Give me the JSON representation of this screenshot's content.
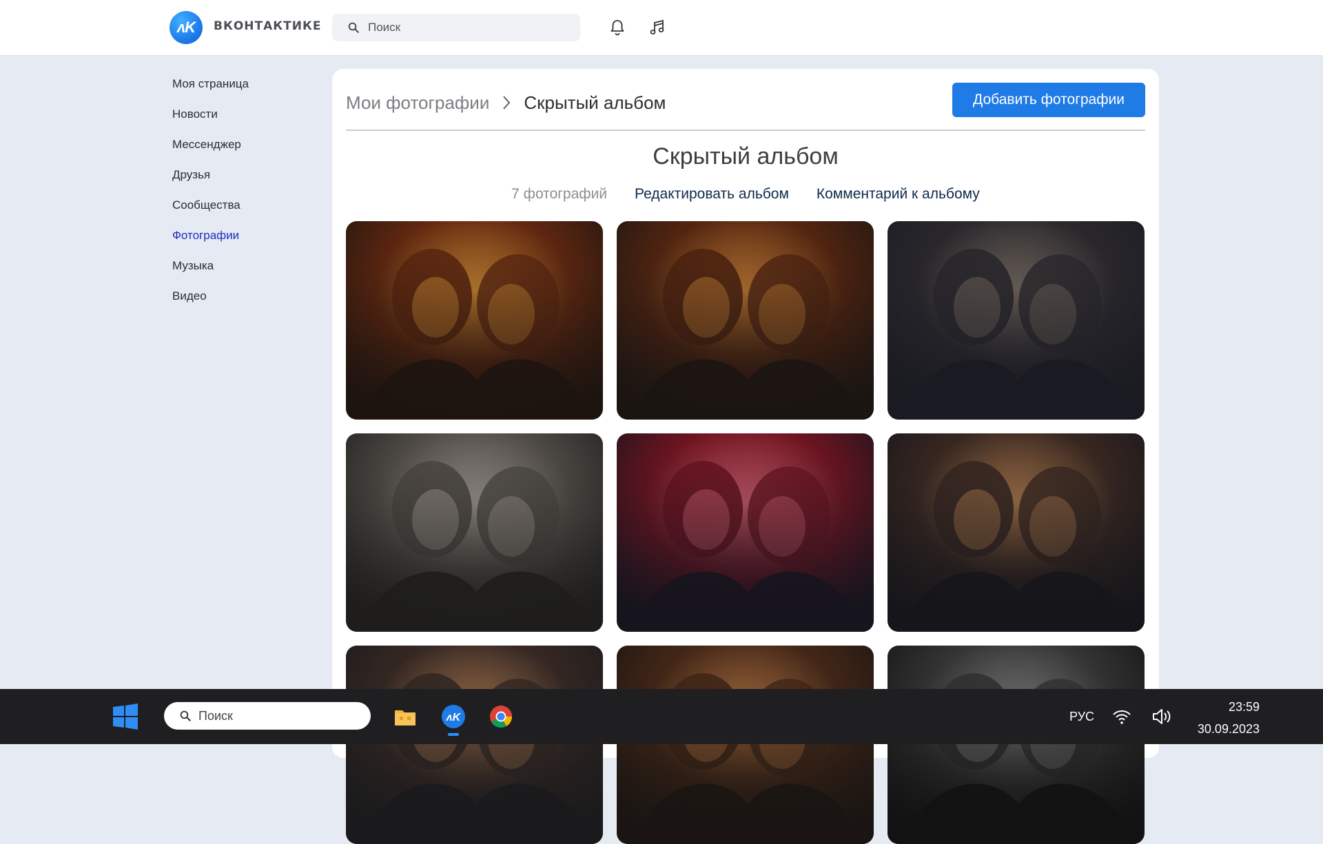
{
  "header": {
    "brand": "ВКОНТАКТИКЕ",
    "logo_letters": "ᴧK",
    "search_placeholder": "Поиск",
    "icons": [
      "bell-icon",
      "music-note-icon"
    ]
  },
  "sidebar": {
    "items": [
      {
        "label": "Моя страница",
        "active": false
      },
      {
        "label": "Новости",
        "active": false
      },
      {
        "label": "Мессенджер",
        "active": false
      },
      {
        "label": "Друзья",
        "active": false
      },
      {
        "label": "Сообщества",
        "active": false
      },
      {
        "label": "Фотографии",
        "active": true
      },
      {
        "label": "Музыка",
        "active": false
      },
      {
        "label": "Видео",
        "active": false
      }
    ]
  },
  "main": {
    "breadcrumb": {
      "parent": "Мои фотографии",
      "current": "Скрытый альбом"
    },
    "add_button": "Добавить фотографии",
    "album_title": "Скрытый альбом",
    "photo_count": "7 фотографий",
    "edit_link": "Редактировать альбом",
    "comment_link": "Комментарий к альбому",
    "photos": [
      {
        "palette": [
          "#f2a23a",
          "#6a2a10",
          "#1d1410"
        ],
        "tone": "warm"
      },
      {
        "palette": [
          "#e7913a",
          "#5b2710",
          "#1b1512"
        ],
        "tone": "warm"
      },
      {
        "palette": [
          "#8a7c6c",
          "#2d2a2e",
          "#1a1b22"
        ],
        "tone": "cool"
      },
      {
        "palette": [
          "#b9b2aa",
          "#55504b",
          "#1e1d1c"
        ],
        "tone": "mono"
      },
      {
        "palette": [
          "#f06a7a",
          "#7a1420",
          "#16141d"
        ],
        "tone": "red"
      },
      {
        "palette": [
          "#c98c55",
          "#3e2a22",
          "#16161a"
        ],
        "tone": "warm-dark"
      },
      {
        "palette": [
          "#c88a58",
          "#3a2a24",
          "#1a1a1c"
        ],
        "tone": "warm"
      },
      {
        "palette": [
          "#d5894d",
          "#4a2a18",
          "#1a1512"
        ],
        "tone": "warm"
      },
      {
        "palette": [
          "#9a9a9a",
          "#3a3a3a",
          "#121212"
        ],
        "tone": "mono"
      }
    ]
  },
  "taskbar": {
    "search_placeholder": "Поиск",
    "apps": [
      "windows-start-icon",
      "file-explorer-icon",
      "vk-app-icon",
      "chrome-icon"
    ],
    "language": "РУС",
    "time": "23:59",
    "date": "30.09.2023"
  },
  "colors": {
    "accent": "#1f7be6",
    "active_nav": "#1b2fbf",
    "page_bg": "#e6eaf3",
    "taskbar_bg": "#1f1f22"
  }
}
